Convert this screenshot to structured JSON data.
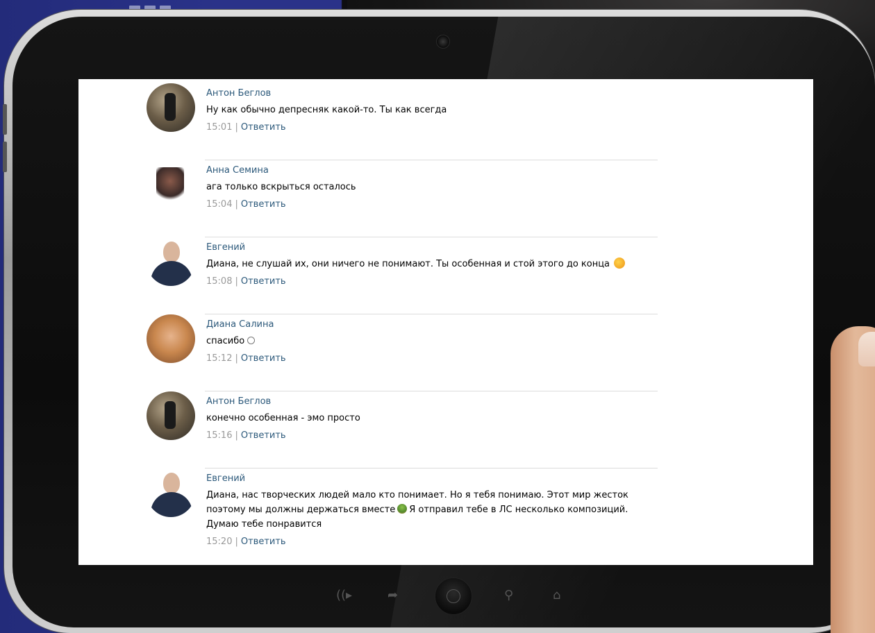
{
  "comments": [
    {
      "author": "Антон Беглов",
      "text": "Ну как обычно депресняк какой-то. Ты как всегда",
      "time": "15:01",
      "reply": "Ответить"
    },
    {
      "author": "Анна Семина",
      "text": "ага только вскрыться осталось",
      "time": "15:04",
      "reply": "Ответить"
    },
    {
      "author": "Евгений",
      "text": "Диана, не слушай их, они ничего не понимают. Ты особенная и стой этого до конца",
      "time": "15:08",
      "reply": "Ответить"
    },
    {
      "author": "Диана Салина",
      "text": "спасибо",
      "time": "15:12",
      "reply": "Ответить"
    },
    {
      "author": "Антон Беглов",
      "text": "конечно особенная - эмо просто",
      "time": "15:16",
      "reply": "Ответить"
    },
    {
      "author": "Евгений",
      "text_line1": "Диана, нас творческих людей мало кто понимает. Но я тебя понимаю. Этот мир жесток",
      "text_line2a": "поэтому мы должны держаться вместе",
      "text_line2b": "Я отправил тебе в ЛС несколько композиций.",
      "text_line3": "Думаю тебе понравится",
      "time": "15:20",
      "reply": "Ответить"
    }
  ],
  "icons": {
    "wink_emoji": "winking-face-emoji",
    "smile_emoji": "smile-emoji",
    "bouquet_emoji": "bouquet-emoji"
  },
  "colors": {
    "author_link": "#2b587a",
    "meta_gray": "#999999"
  }
}
